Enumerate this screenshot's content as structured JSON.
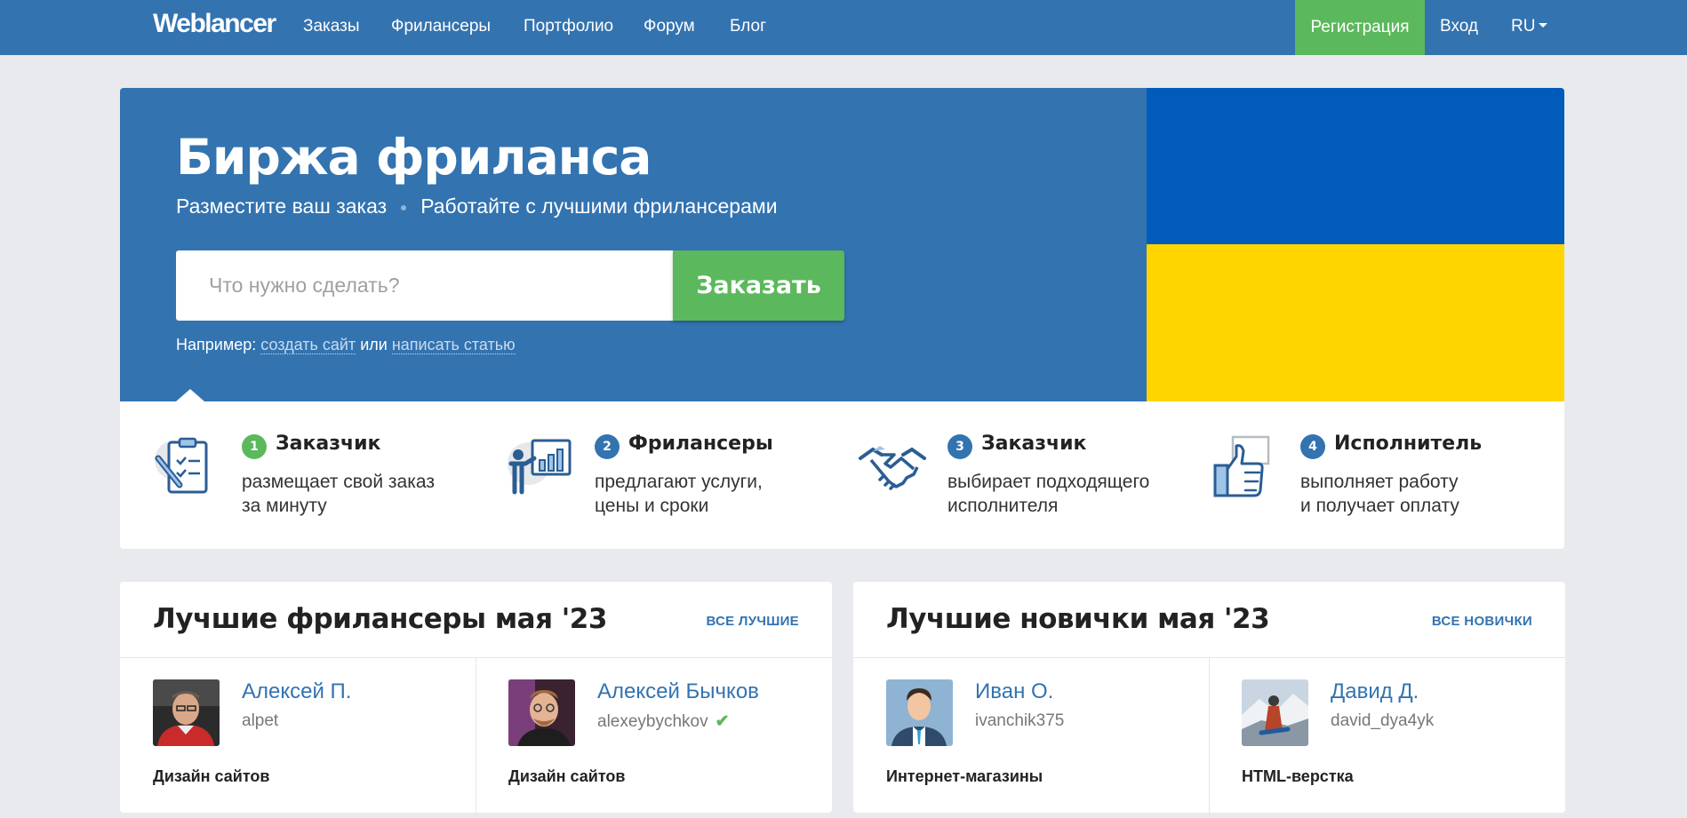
{
  "header": {
    "logo": "Weblancer",
    "nav": [
      "Заказы",
      "Фрилансеры",
      "Портфолио",
      "Форум",
      "Блог"
    ],
    "register": "Регистрация",
    "login": "Вход",
    "lang": "RU"
  },
  "hero": {
    "title": "Биржа фриланса",
    "sub_left": "Разместите ваш заказ",
    "sub_right": "Работайте с лучшими фрилансерами",
    "search_placeholder": "Что нужно сделать?",
    "order_button": "Заказать",
    "example_prefix": "Например:",
    "example_link1": "создать сайт",
    "example_or": "или",
    "example_link2": "написать статью",
    "flag_colors": [
      "#005bbb",
      "#ffd500"
    ]
  },
  "steps": [
    {
      "num": "1",
      "title": "Заказчик",
      "line1": "размещает свой заказ",
      "line2": "за минуту",
      "icon": "clipboard-icon",
      "color": "#5cb85c"
    },
    {
      "num": "2",
      "title": "Фрилансеры",
      "line1": "предлагают услуги,",
      "line2": "цены и сроки",
      "icon": "presentation-icon",
      "color": "#3373b0"
    },
    {
      "num": "3",
      "title": "Заказчик",
      "line1": "выбирает подходящего",
      "line2": "исполнителя",
      "icon": "handshake-icon",
      "color": "#3373b0"
    },
    {
      "num": "4",
      "title": "Исполнитель",
      "line1": "выполняет работу",
      "line2": "и получает оплату",
      "icon": "thumbs-up-icon",
      "color": "#3373b0"
    }
  ],
  "best": {
    "title": "Лучшие фрилансеры мая '23",
    "link": "ВСЕ ЛУЧШИЕ",
    "people": [
      {
        "name": "Алексей П.",
        "login": "alpet",
        "category": "Дизайн сайтов",
        "verified": false
      },
      {
        "name": "Алексей Бычков",
        "login": "alexeybychkov",
        "category": "Дизайн сайтов",
        "verified": true
      }
    ]
  },
  "newbies": {
    "title": "Лучшие новички мая '23",
    "link": "ВСЕ НОВИЧКИ",
    "people": [
      {
        "name": "Иван О.",
        "login": "ivanchik375",
        "category": "Интернет-магазины",
        "verified": false
      },
      {
        "name": "Давид Д.",
        "login": "david_dya4yk",
        "category": "HTML-верстка",
        "verified": false
      }
    ]
  },
  "colors": {
    "brand": "#3373b0",
    "accent": "#5cb85c"
  }
}
